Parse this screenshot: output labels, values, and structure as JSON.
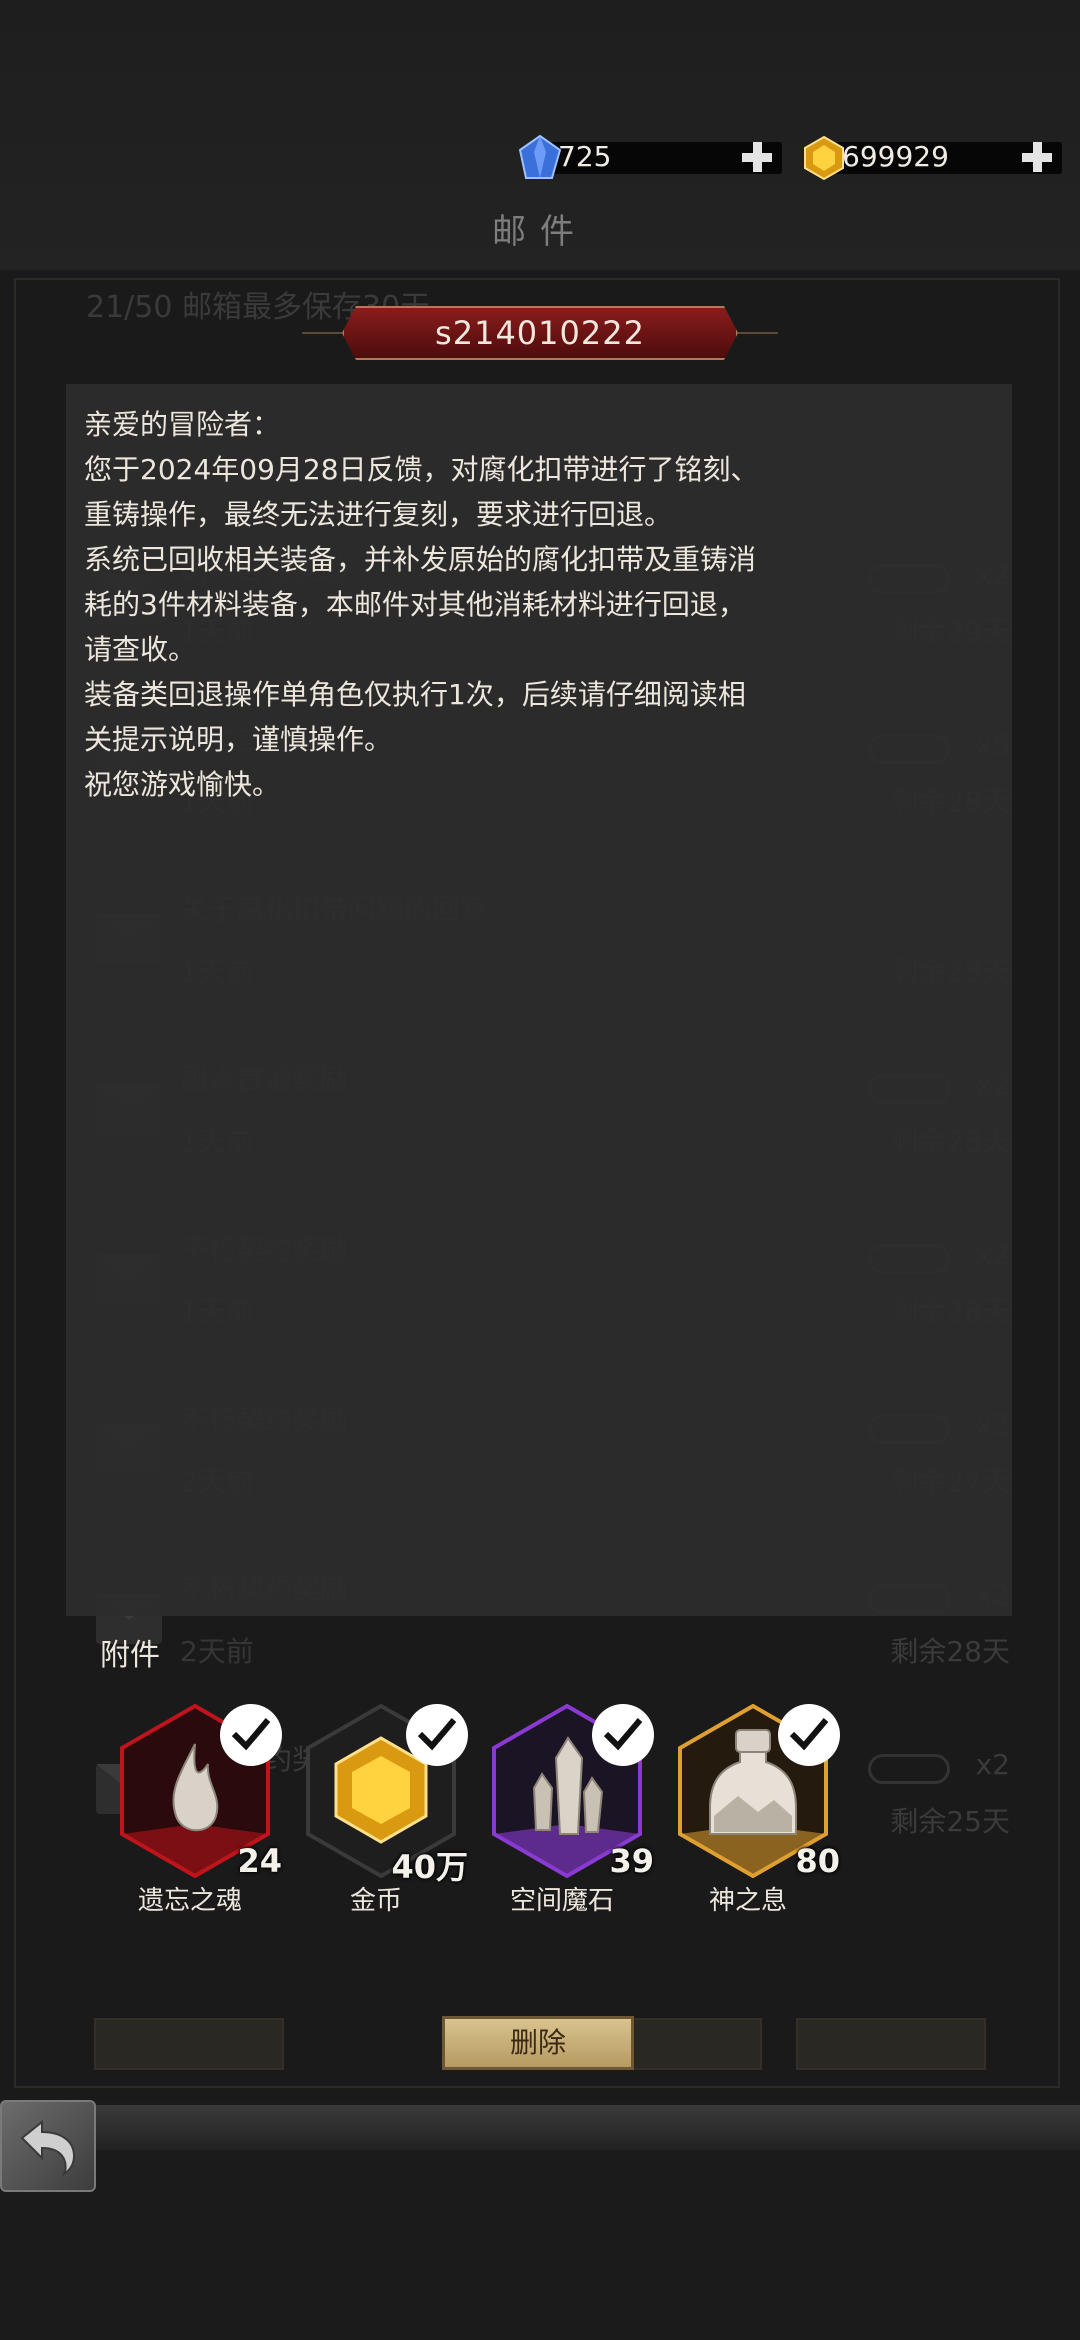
{
  "screen_title": "邮件",
  "currency": {
    "gems": {
      "icon": "blue-crystal-icon",
      "value": "725"
    },
    "gold": {
      "icon": "gold-gem-icon",
      "value": "699929"
    }
  },
  "mail": {
    "id": "s214010222",
    "body_lines": [
      "亲爱的冒险者：",
      "您于2024年09月28日反馈，对腐化扣带进行了铭刻、",
      "重铸操作，最终无法进行复刻，要求进行回退。",
      "系统已回收相关装备，并补发原始的腐化扣带及重铸消",
      "耗的3件材料装备，本邮件对其他消耗材料进行回退，",
      "请查收。",
      "装备类回退操作单角色仅执行1次，后续请仔细阅读相",
      "关提示说明，谨慎操作。",
      "祝您游戏愉快。"
    ]
  },
  "attachments": {
    "heading": "附件",
    "items": [
      {
        "name": "遗忘之魂",
        "count": "24",
        "icon": "flame-soul-icon",
        "frame_color": "#c0141c"
      },
      {
        "name": "金币",
        "count": "40万",
        "icon": "gold-gem-icon",
        "frame_color": "#2a2a2a"
      },
      {
        "name": "空间魔石",
        "count": "39",
        "icon": "crystal-shard-icon",
        "frame_color": "#8a3ad2"
      },
      {
        "name": "神之息",
        "count": "80",
        "icon": "bottle-icon",
        "frame_color": "#e0a030"
      }
    ]
  },
  "actions": {
    "delete_label": "删除"
  },
  "background_list": {
    "summary": "21/50 邮箱最多保存30天",
    "rows": [
      {
        "title": "副本首通奖励",
        "time": "1天前",
        "remain": "剩余29天",
        "qty": "x2"
      },
      {
        "title": "副本首通奖励",
        "time": "1天前",
        "remain": "剩余28天",
        "qty": "x5"
      },
      {
        "title": "关于腐化扣带问题的回复",
        "time": "1天前",
        "remain": "剩余28天",
        "qty": ""
      },
      {
        "title": "副本首通奖励",
        "time": "1天前",
        "remain": "剩余28天",
        "qty": "x2"
      },
      {
        "title": "不朽契约奖励",
        "time": "1天前",
        "remain": "剩余28天",
        "qty": "x2"
      },
      {
        "title": "不朽契约奖励",
        "time": "2天前",
        "remain": "剩余27天",
        "qty": "x2"
      },
      {
        "title": "不朽契约奖励",
        "time": "2天前",
        "remain": "剩余28天",
        "qty": "x2"
      },
      {
        "title": "不朽契约奖励",
        "time": "4天前",
        "remain": "剩余25天",
        "qty": "x2"
      }
    ]
  }
}
